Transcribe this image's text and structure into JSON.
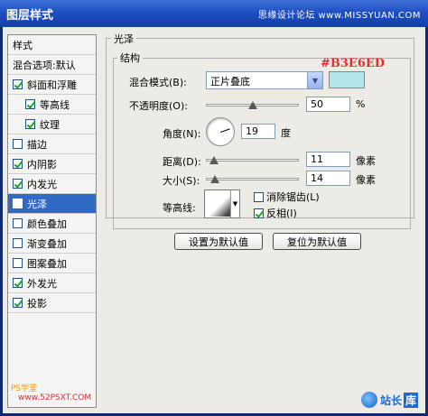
{
  "window": {
    "title": "图层样式",
    "watermark": "思缘设计论坛 www.MISSYUAN.COM"
  },
  "sidebar": {
    "items": [
      {
        "label": "样式",
        "type": "plain",
        "checked": null
      },
      {
        "label": "混合选项:默认",
        "type": "plain",
        "checked": null
      },
      {
        "label": "斜面和浮雕",
        "type": "check",
        "checked": true
      },
      {
        "label": "等高线",
        "type": "sub",
        "checked": true
      },
      {
        "label": "纹理",
        "type": "sub",
        "checked": true
      },
      {
        "label": "描边",
        "type": "check",
        "checked": false
      },
      {
        "label": "内阴影",
        "type": "check",
        "checked": true
      },
      {
        "label": "内发光",
        "type": "check",
        "checked": true
      },
      {
        "label": "光泽",
        "type": "check",
        "checked": true,
        "selected": true
      },
      {
        "label": "颜色叠加",
        "type": "check",
        "checked": false
      },
      {
        "label": "渐变叠加",
        "type": "check",
        "checked": false
      },
      {
        "label": "图案叠加",
        "type": "check",
        "checked": false
      },
      {
        "label": "外发光",
        "type": "check",
        "checked": true
      },
      {
        "label": "投影",
        "type": "check",
        "checked": true
      }
    ],
    "footer_left": "PS学堂",
    "footer_site": "www.52PSXT.COM"
  },
  "panel": {
    "section_title": "光泽",
    "group_title": "结构",
    "color_hex_annotation": "#B3E6ED",
    "swatch_color": "#b3e6ed",
    "blend_mode_label": "混合模式(B):",
    "blend_mode_value": "正片叠底",
    "opacity_label": "不透明度(O):",
    "opacity_value": "50",
    "opacity_unit": "%",
    "opacity_fraction": 0.5,
    "angle_label": "角度(N):",
    "angle_value": "19",
    "angle_unit": "度",
    "distance_label": "距离(D):",
    "distance_value": "11",
    "distance_unit": "像素",
    "size_label": "大小(S):",
    "size_value": "14",
    "size_unit": "像素",
    "contour_label": "等高线:",
    "antialias_label": "消除锯齿(L)",
    "antialias_checked": false,
    "invert_label": "反相(I)",
    "invert_checked": true,
    "default_button": "设置为默认值",
    "reset_button": "复位为默认值"
  },
  "branding": {
    "logo_text": "站长",
    "logo_suffix": "库"
  }
}
